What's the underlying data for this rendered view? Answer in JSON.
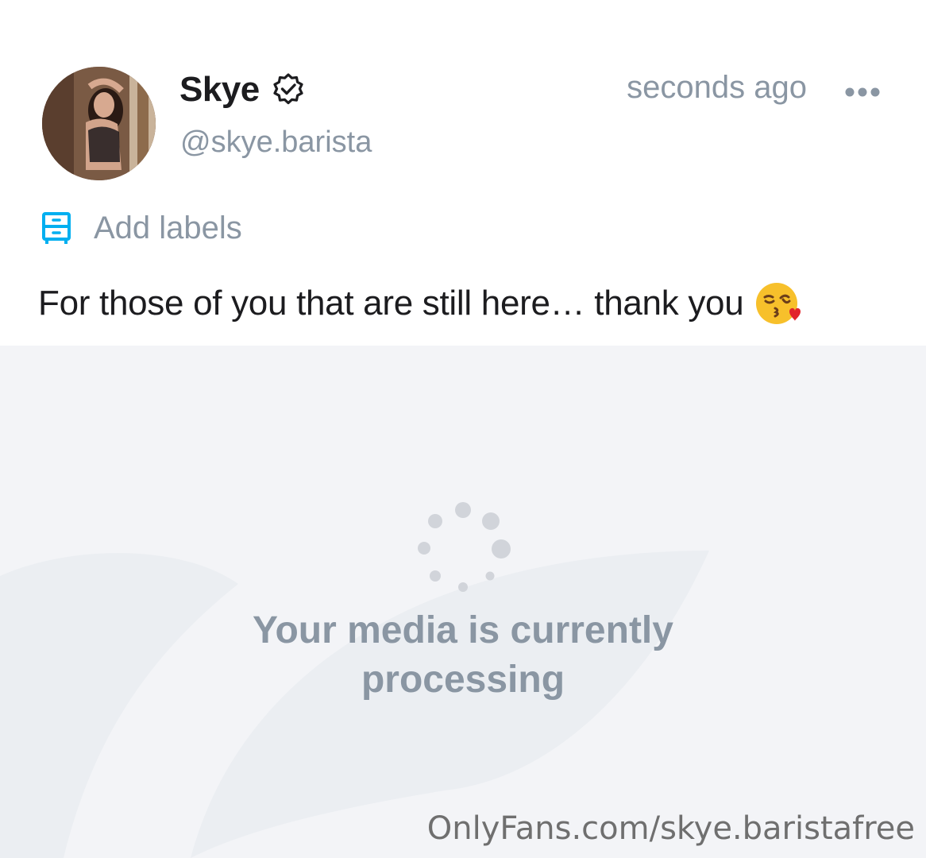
{
  "post": {
    "author": {
      "name": "Skye",
      "handle": "@skye.barista",
      "verified": true
    },
    "timestamp": "seconds ago",
    "labels_action": "Add labels",
    "text": "For those of you that are still here… thank you",
    "text_emoji": "kissing-heart-emoji",
    "media_status": "Your media is currently processing"
  },
  "watermark": "OnlyFans.com/skye.baristafree",
  "colors": {
    "accent": "#00aff0",
    "muted_text": "#8a96a3",
    "primary_text": "#1c1c1f",
    "media_bg": "#f3f4f7"
  },
  "icons": {
    "verified": "verified-badge-icon",
    "more": "more-dots-icon",
    "labels": "label-drawer-icon",
    "spinner": "loading-spinner-icon"
  }
}
